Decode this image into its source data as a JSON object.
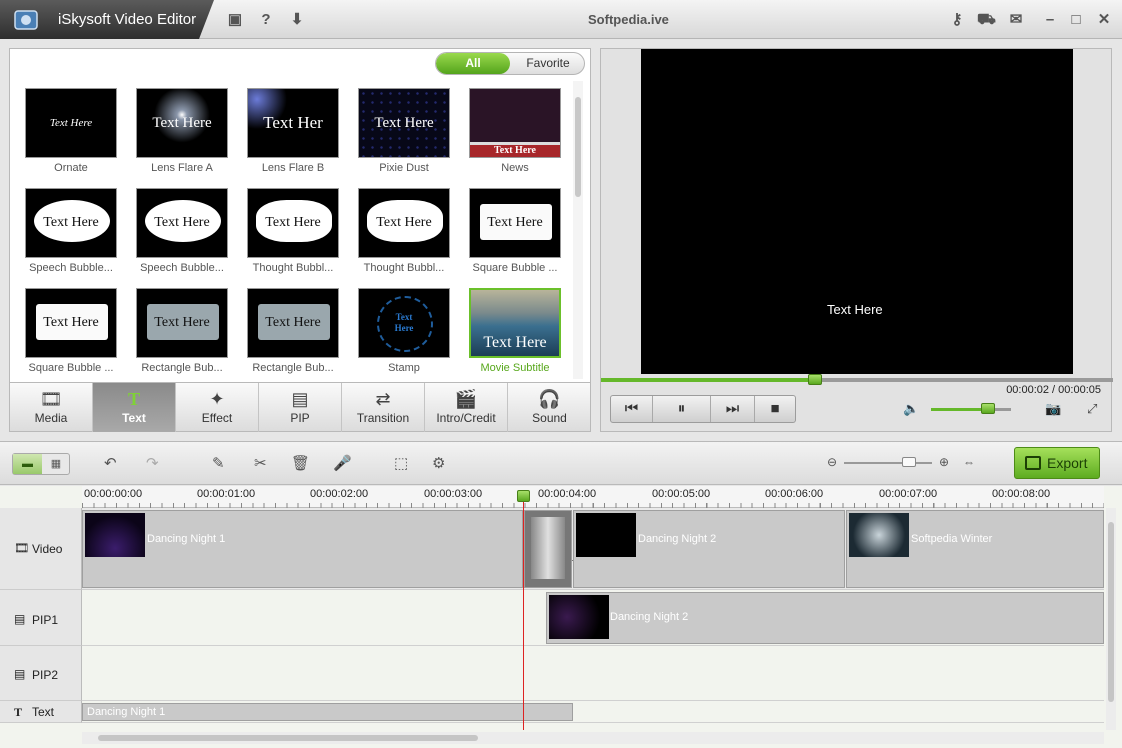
{
  "app": {
    "title": "iSkysoft Video Editor",
    "watermark": "Softpedia.ive"
  },
  "library": {
    "filter_all": "All",
    "filter_favorite": "Favorite",
    "items": [
      {
        "label": "Ornate",
        "text": "Text Here"
      },
      {
        "label": "Lens Flare A",
        "text": "Text Here"
      },
      {
        "label": "Lens Flare B",
        "text": "Text Her"
      },
      {
        "label": "Pixie Dust",
        "text": "Text Here"
      },
      {
        "label": "News",
        "text": "Text Here"
      },
      {
        "label": "Speech Bubble...",
        "text": "Text Here"
      },
      {
        "label": "Speech Bubble...",
        "text": "Text Here"
      },
      {
        "label": "Thought Bubbl...",
        "text": "Text Here"
      },
      {
        "label": "Thought Bubbl...",
        "text": "Text Here"
      },
      {
        "label": "Square Bubble ...",
        "text": "Text Here"
      },
      {
        "label": "Square Bubble ...",
        "text": "Text Here"
      },
      {
        "label": "Rectangle Bub...",
        "text": "Text Here"
      },
      {
        "label": "Rectangle Bub...",
        "text": "Text Here"
      },
      {
        "label": "Stamp",
        "text": "Text Here"
      },
      {
        "label": "Movie Subtitle",
        "text": "Text Here"
      }
    ]
  },
  "tabs": [
    "Media",
    "Text",
    "Effect",
    "PIP",
    "Transition",
    "Intro/Credit",
    "Sound"
  ],
  "preview": {
    "overlay_text": "Text Here",
    "time": "00:00:02 / 00:00:05",
    "progress": 0.42,
    "volume": 0.72
  },
  "toolbar": {
    "export": "Export"
  },
  "timeline": {
    "ticks": [
      "00:00:00:00",
      "00:00:01:00",
      "00:00:02:00",
      "00:00:03:00",
      "00:00:04:00",
      "00:00:05:00",
      "00:00:06:00",
      "00:00:07:00",
      "00:00:08:00"
    ],
    "tracks": [
      "Video",
      "PIP1",
      "PIP2",
      "Text"
    ],
    "clips": {
      "v1": "Dancing Night 1",
      "v2": "Dancing Night 2",
      "v3": "Softpedia Winter",
      "pip1": "Dancing Night 2",
      "text1": "Dancing Night 1"
    }
  }
}
